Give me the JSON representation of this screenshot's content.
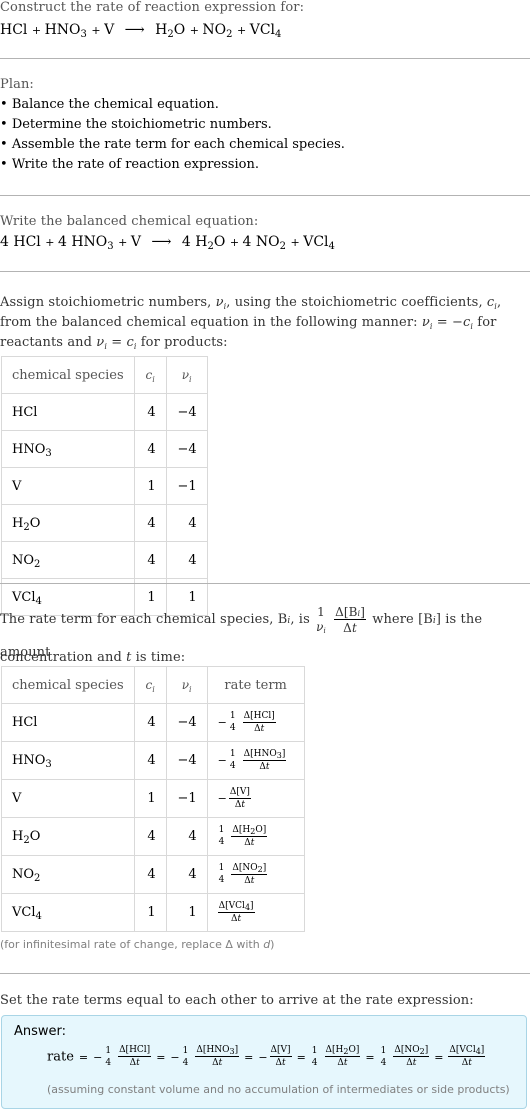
{
  "intro": {
    "label": "Construct the rate of reaction expression for:",
    "reaction": {
      "reactants": [
        {
          "coef": "",
          "formula": "HCl"
        },
        {
          "coef": "",
          "formula": "HNO",
          "sub": "3"
        },
        {
          "coef": "",
          "formula": "V"
        }
      ],
      "products": [
        {
          "coef": "",
          "formula": "H",
          "sub": "2",
          "tail": "O"
        },
        {
          "coef": "",
          "formula": "NO",
          "sub": "2"
        },
        {
          "coef": "",
          "formula": "VCl",
          "sub": "4"
        }
      ]
    }
  },
  "plan": {
    "label": "Plan:",
    "steps": [
      "Balance the chemical equation.",
      "Determine the stoichiometric numbers.",
      "Assemble the rate term for each chemical species.",
      "Write the rate of reaction expression."
    ]
  },
  "balanced": {
    "label": "Write the balanced chemical equation:",
    "coefs": {
      "HCl": "4",
      "HNO3": "4",
      "V": "",
      "H2O": "4",
      "NO2": "4",
      "VCl4": ""
    }
  },
  "assign": {
    "text_line1": "Assign stoichiometric numbers, ν",
    "text": "Assign stoichiometric numbers, νi, using the stoichiometric coefficients, ci, from the balanced chemical equation in the following manner: νi = −ci for reactants and νi = ci for products:",
    "table": {
      "headers": [
        "chemical species",
        "c",
        "ν"
      ],
      "rows": [
        {
          "species": "HCl",
          "base": "HCl",
          "sub": "",
          "tail": "",
          "c": "4",
          "v": "−4"
        },
        {
          "species": "HNO3",
          "base": "HNO",
          "sub": "3",
          "tail": "",
          "c": "4",
          "v": "−4"
        },
        {
          "species": "V",
          "base": "V",
          "sub": "",
          "tail": "",
          "c": "1",
          "v": "−1"
        },
        {
          "species": "H2O",
          "base": "H",
          "sub": "2",
          "tail": "O",
          "c": "4",
          "v": "4"
        },
        {
          "species": "NO2",
          "base": "NO",
          "sub": "2",
          "tail": "",
          "c": "4",
          "v": "4"
        },
        {
          "species": "VCl4",
          "base": "VCl",
          "sub": "4",
          "tail": "",
          "c": "1",
          "v": "1"
        }
      ]
    }
  },
  "rate_terms": {
    "text_a": "The rate term for each chemical species, B",
    "text_b": ", is",
    "text_c": "where [B",
    "text_d": "] is the amount",
    "text_e": "concentration and",
    "text_f": "is time:",
    "t_symbol": "t",
    "table": {
      "headers": [
        "chemical species",
        "c",
        "ν",
        "rate term"
      ],
      "rows": [
        {
          "base": "HCl",
          "sub": "",
          "tail": "",
          "c": "4",
          "v": "−4",
          "sign": "−",
          "factor": "4"
        },
        {
          "base": "HNO",
          "sub": "3",
          "tail": "",
          "c": "4",
          "v": "−4",
          "sign": "−",
          "factor": "4"
        },
        {
          "base": "V",
          "sub": "",
          "tail": "",
          "c": "1",
          "v": "−1",
          "sign": "−",
          "factor": ""
        },
        {
          "base": "H",
          "sub": "2",
          "tail": "O",
          "c": "4",
          "v": "4",
          "sign": "",
          "factor": "4"
        },
        {
          "base": "NO",
          "sub": "2",
          "tail": "",
          "c": "4",
          "v": "4",
          "sign": "",
          "factor": "4"
        },
        {
          "base": "VCl",
          "sub": "4",
          "tail": "",
          "c": "1",
          "v": "1",
          "sign": "",
          "factor": ""
        }
      ]
    },
    "note_a": "(for infinitesimal rate of change, replace Δ with ",
    "note_d": "d",
    "note_b": ")"
  },
  "final": {
    "label": "Set the rate terms equal to each other to arrive at the rate expression:",
    "answer_label": "Answer:",
    "rate_word": "rate",
    "note": "(assuming constant volume and no accumulation of intermediates or side products)"
  },
  "symbols": {
    "delta": "Δ",
    "dt": "Δt",
    "one": "1",
    "plus": "+",
    "arrow": "⟶",
    "equals": "="
  }
}
